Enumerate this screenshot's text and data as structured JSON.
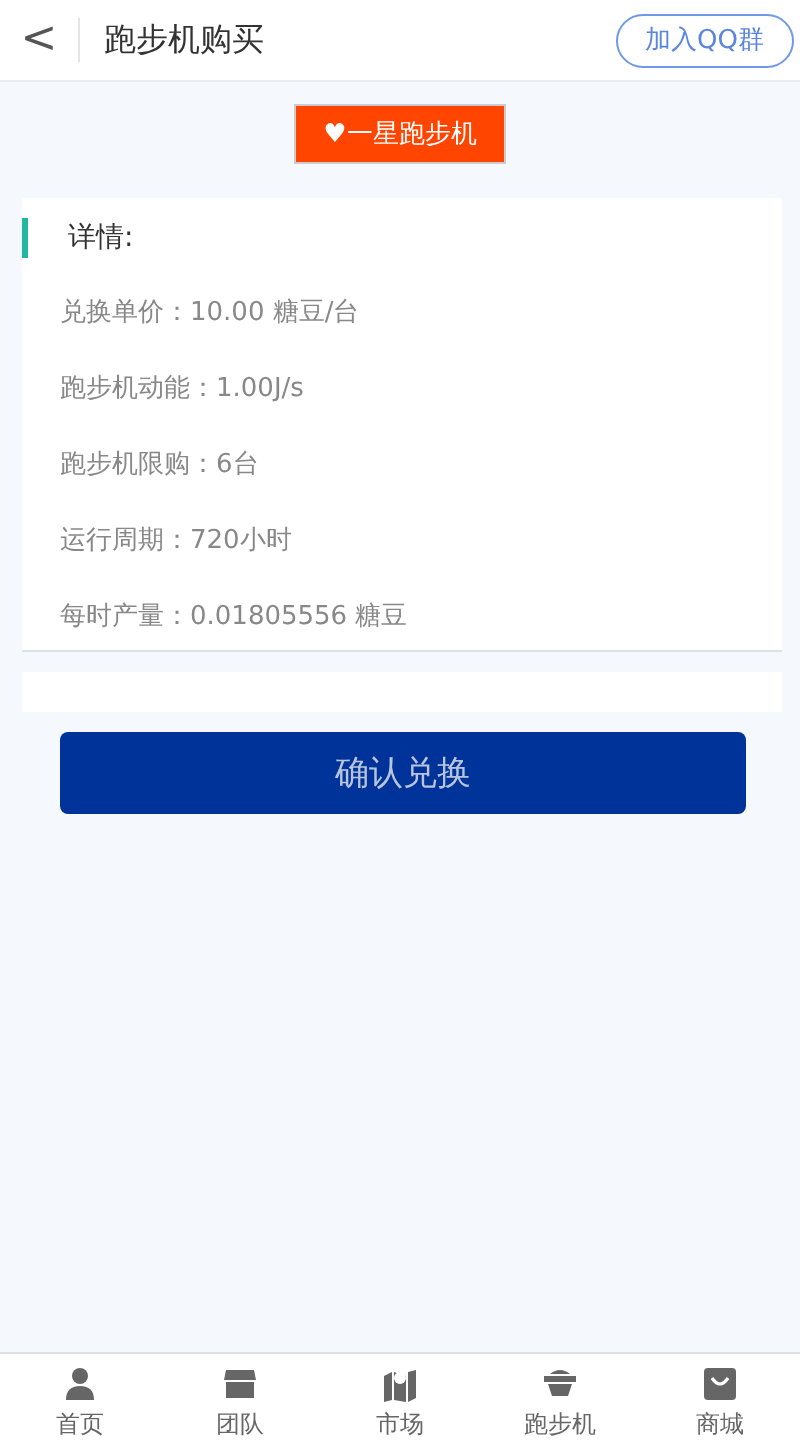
{
  "header": {
    "back": "<",
    "title": "跑步机购买",
    "action": "加入QQ群"
  },
  "badge": "♥一星跑步机",
  "details": {
    "title": "详情:",
    "rows": [
      "兑换单价：10.00 糖豆/台",
      "跑步机动能：1.00J/s",
      "跑步机限购：6台",
      "运行周期：720小时",
      "每时产量：0.01805556 糖豆"
    ]
  },
  "confirm_button": "确认兑换",
  "tab_bar": [
    {
      "label": "首页",
      "kind": "person",
      "selected": false
    },
    {
      "label": "团队",
      "kind": "shop",
      "selected": false
    },
    {
      "label": "市场",
      "kind": "map",
      "selected": false
    },
    {
      "label": "跑步机",
      "kind": "machine",
      "selected": false
    },
    {
      "label": "商城",
      "kind": "bag",
      "selected": false
    }
  ]
}
